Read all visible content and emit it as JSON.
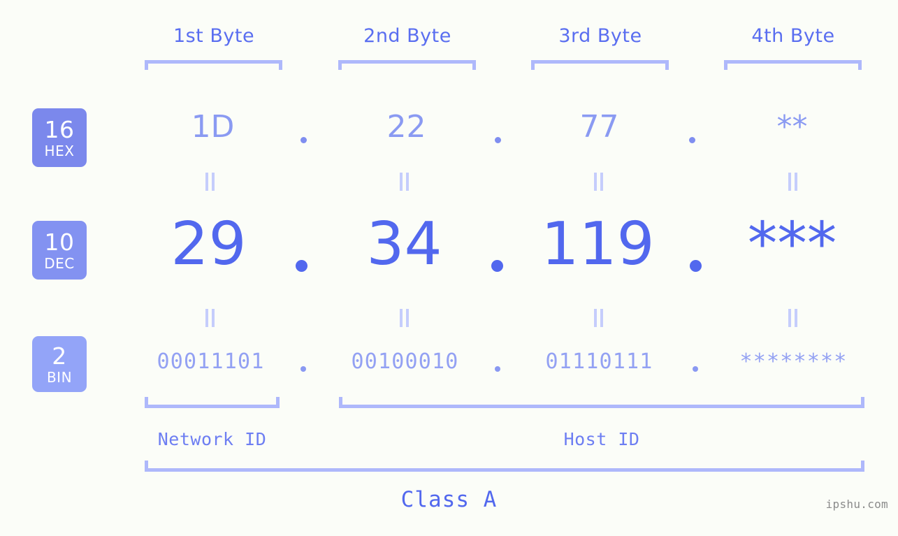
{
  "page": {
    "background_color": "#fbfdf8",
    "watermark": "ipshu.com",
    "class_label": "Class A"
  },
  "colors": {
    "header_text": "#5a6ef0",
    "bracket": "#aeb8fb",
    "hex_text": "#8a9af2",
    "dec_text": "#5268ee",
    "bin_text": "#93a1f3",
    "badge_hex": "#7b88ec",
    "badge_dec": "#8392f1",
    "badge_bin": "#93a4f8",
    "equals_connector": "#c5cdfc",
    "watermark": "#8b8b8b"
  },
  "headers": {
    "bytes": [
      {
        "label": "1st Byte"
      },
      {
        "label": "2nd Byte"
      },
      {
        "label": "3rd Byte"
      },
      {
        "label": "4th Byte"
      }
    ]
  },
  "badges": [
    {
      "base": "16",
      "name": "HEX"
    },
    {
      "base": "10",
      "name": "DEC"
    },
    {
      "base": "2",
      "name": "BIN"
    }
  ],
  "rows": {
    "hex": {
      "base": "16",
      "name": "HEX",
      "octets": [
        "1D",
        "22",
        "77",
        "**"
      ],
      "separator": "."
    },
    "dec": {
      "base": "10",
      "name": "DEC",
      "octets": [
        "29",
        "34",
        "119",
        "***"
      ],
      "separator": "."
    },
    "bin": {
      "base": "2",
      "name": "BIN",
      "octets": [
        "00011101",
        "00100010",
        "01110111",
        "********"
      ],
      "separator": "."
    }
  },
  "equals_symbol": "=",
  "id_spans": [
    {
      "label": "Network ID"
    },
    {
      "label": "Host ID"
    }
  ],
  "address": {
    "decimal": "29.34.119.***",
    "hexadecimal": "1D.22.77.**",
    "binary": "00011101.00100010.01110111.********"
  }
}
